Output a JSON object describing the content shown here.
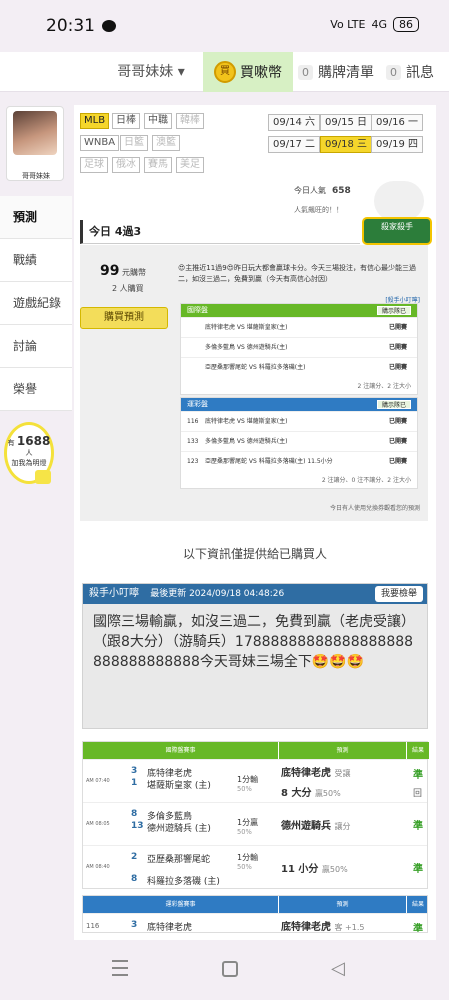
{
  "status_bar": {
    "time": "20:31",
    "network": "Vo LTE",
    "signal": "4G",
    "battery": "86"
  },
  "topnav": {
    "user": "哥哥妹妹",
    "buy_coin": "買",
    "buy": "買嗽幣",
    "cart_count": "0",
    "cart": "購牌清單",
    "msg_count": "0",
    "msg": "訊息"
  },
  "sidebar": {
    "username": "哥哥妹妹",
    "items": [
      {
        "label": "預測"
      },
      {
        "label": "戰績"
      },
      {
        "label": "遊戲紀錄"
      },
      {
        "label": "討論"
      },
      {
        "label": "榮譽"
      }
    ],
    "followers_prefix": "有",
    "followers": "1688",
    "followers_suffix": "人",
    "followers_sub": "加我為明燈"
  },
  "sports": [
    [
      "MLB",
      "日棒",
      "中職",
      "韓棒"
    ],
    [
      "WNBA",
      "日籃",
      "澳籃"
    ],
    [
      "足球",
      "俄冰",
      "賽馬",
      "美足"
    ]
  ],
  "dates": [
    [
      {
        "d": "09/14",
        "w": "六"
      },
      {
        "d": "09/15",
        "w": "日"
      },
      {
        "d": "09/16",
        "w": "一"
      }
    ],
    [
      {
        "d": "09/17",
        "w": "二"
      },
      {
        "d": "09/18",
        "w": "三"
      },
      {
        "d": "09/19",
        "w": "四"
      }
    ]
  ],
  "stats": {
    "today_pop_label": "今日人氣",
    "today_pop": "658",
    "pop_note": "人氣飆旺的！！"
  },
  "today_title": "今日 4過3",
  "medal": "殺家殺手",
  "preview": {
    "price": "99",
    "price_unit": "元購幣",
    "buyers": "2",
    "buyers_unit": "人購買",
    "buy_btn": "購買預測",
    "desc": "😍主推近11過9😍昨日玩大都會贏球卡分。今天三場投注，有信心最少能三過二，如沒三過二，免費到贏（今天有高信心討因）",
    "link": "[殺手小叮嚀]",
    "kill_header": "國際盤",
    "hot_header": "運彩盤",
    "button": "購示隊已"
  },
  "kill_rows": [
    {
      "id": "",
      "text": "底特律老虎 VS 堪薩斯皇家(主)",
      "state": "已開賽"
    },
    {
      "id": "",
      "text": "多倫多藍鳥 VS 德州遊騎兵(主)",
      "state": "已開賽"
    },
    {
      "id": "",
      "text": "亞歷桑那響尾蛇 VS 科羅拉多落磯(主)",
      "state": "已開賽"
    }
  ],
  "hot_rows": [
    {
      "id": "116",
      "text": "底特律老虎 VS 堪薩斯皇家(主)",
      "state": "已開賽"
    },
    {
      "id": "133",
      "text": "多倫多藍鳥 VS 德州遊騎兵(主)",
      "state": "已開賽"
    },
    {
      "id": "123",
      "text": "亞歷桑那響尾蛇 VS 科羅拉多落磯(主) 11.5小分",
      "state": "已開賽"
    }
  ],
  "foot1": "2 注讓分、2 注大小",
  "foot2": "2 注讓分、0 注不讓分、2 注大小",
  "foot3": "今日有人使用兌換券觀看您的預測",
  "info_text": "以下資訊僅提供給已購買人",
  "board": {
    "title": "殺手小叮嚀",
    "updated_label": "最後更新",
    "updated": "2024/09/18 04:48:26",
    "report": "我要檢舉",
    "body": "國際三場輸贏，如沒三過二，免費到贏（老虎受讓）（跟8大分）（游騎兵）17888888888888888888888888888888今天哥妹三場全下🤩🤩🤩"
  },
  "table1": {
    "h1": "國際盤賽事",
    "h2": "預測",
    "h3": "結果",
    "rows": [
      {
        "time": "AM 07:40",
        "n1": "3",
        "n2": "1",
        "t1": "底特律老虎",
        "t2": "堪薩斯皇家 (主)",
        "hc": "1分輸",
        "hcp": "50%",
        "p1": "底特律老虎",
        "p1s": "受讓",
        "p2": "8 大分",
        "p2s": "贏50%",
        "r1": "準",
        "r2": "回"
      },
      {
        "time": "AM 08:05",
        "n1": "8",
        "n2": "13",
        "t1": "多倫多藍鳥",
        "t2": "德州遊騎兵 (主)",
        "hc": "1分贏",
        "hcp": "50%",
        "p1": "德州遊騎兵",
        "p1s": "讓分",
        "p2": "",
        "p2s": "",
        "r1": "準",
        "r2": ""
      },
      {
        "time": "AM 08:40",
        "n1": "2",
        "n2": "8",
        "t1": "亞歷桑那響尾蛇",
        "t2": "科羅拉多落磯 (主)",
        "hc": "1分輸",
        "hcp": "50%",
        "p1": "11 小分",
        "p1s": "贏50%",
        "p2": "",
        "p2s": "",
        "r1": "準",
        "r2": ""
      }
    ]
  },
  "table2": {
    "h1": "運彩盤賽事",
    "h2": "預測",
    "h3": "結果",
    "rows": [
      {
        "time": "116",
        "n1": "3",
        "n2": "",
        "t1": "底特律老虎",
        "t2": "",
        "p1": "底特律老虎",
        "p1s": "客 +1.5",
        "r1": "準"
      }
    ]
  }
}
